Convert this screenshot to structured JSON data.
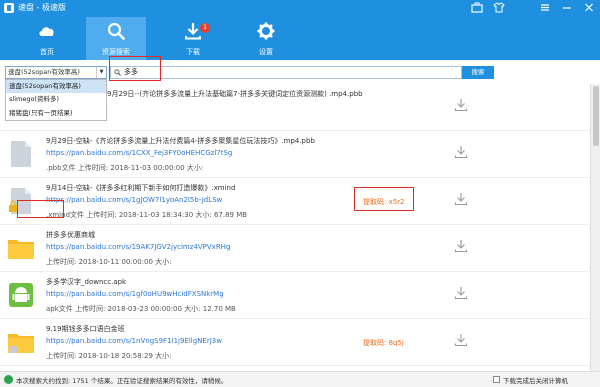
{
  "window": {
    "title": "速盘 - 极速版",
    "controls": [
      "briefcase-icon",
      "shirt-icon",
      "menu-icon",
      "minimize-icon",
      "close-icon"
    ]
  },
  "nav": {
    "tabs": [
      {
        "label": "首页",
        "icon": "cloud-icon"
      },
      {
        "label": "资源搜索",
        "icon": "search-icon",
        "active": true
      },
      {
        "label": "下载",
        "icon": "download-icon",
        "badge": "1"
      },
      {
        "label": "设置",
        "icon": "gear-icon"
      }
    ]
  },
  "search": {
    "source_selected": "速盘(52sopan有效率高)",
    "query": "多多",
    "button_label": "搜索",
    "source_options": [
      "速盘(52sopan有效率高)",
      "slimego(资料多)",
      "猪猪盘(只有一页结果)"
    ]
  },
  "results": [
    {
      "title": "9月29日--(齐论拼多多流量上升法基础篇7-拼多多关键词定位资源测款) .mp4.pbb",
      "link": "",
      "meta": "",
      "code": "",
      "icon": "file-icon"
    },
    {
      "title": "9月29日-空缺-《齐论拼多多流量上升法付费篇4-拼多多聚集星位玩法技巧》.mp4.pbb",
      "link": "https://pan.baidu.com/s/1CXX_Fej3FY0oHEHCGzl7tSg",
      "meta": ".pbb文件  上传时间: 2018-11-03 00:00:00  大小:",
      "code": "",
      "icon": "file-icon"
    },
    {
      "title": "9月14日-空缺-《拼多多红利期下新手如何打造爆款》.xmind",
      "link": "https://pan.baidu.com/s/1gJOW7l1yoAn2l5b-JdLSw",
      "meta": ".xmind文件  上传时间: 2018-11-03 18:34:30  大小: 67.89 MB",
      "code": "提取码: x5r2",
      "icon": "locked-file-icon"
    },
    {
      "title": "拼多多优惠商城",
      "link": "https://pan.baidu.com/s/19AK7JGV2jycimz4VPVxRHg",
      "meta": "上传时间: 2018-10-11 00:00:00  大小:",
      "code": "",
      "icon": "folder-icon"
    },
    {
      "title": "多多学汉字_downcc.apk",
      "link": "https://pan.baidu.com/s/1gf0oHU9wHcidFXSNkrMg",
      "meta": "apk文件  上传时间: 2018-03-23 00:00:00  大小: 12.70 MB",
      "code": "",
      "icon": "android-icon"
    },
    {
      "title": "9.19期钱多多口语白金班",
      "link": "https://pan.baidu.com/s/1nVngS9F1I1j9EllgNErJ3w",
      "meta": "上传时间: 2018-10-18 20:58:29  大小:",
      "code": "提取码: 8q5j",
      "icon": "locked-folder-icon"
    }
  ],
  "status": {
    "text": "本次搜索大约找到: 1751 个结果。正在验证搜索结果的有效性，请稍候。",
    "shutdown_label": "下载完成后关闭计算机"
  },
  "colors": {
    "header": "#1f8fe0",
    "active_tab": "#4eacef",
    "link": "#2b77d5",
    "code": "#e86a1b",
    "highlight": "#e02b20",
    "folder": "#f7b928",
    "android": "#6cbf3f"
  }
}
